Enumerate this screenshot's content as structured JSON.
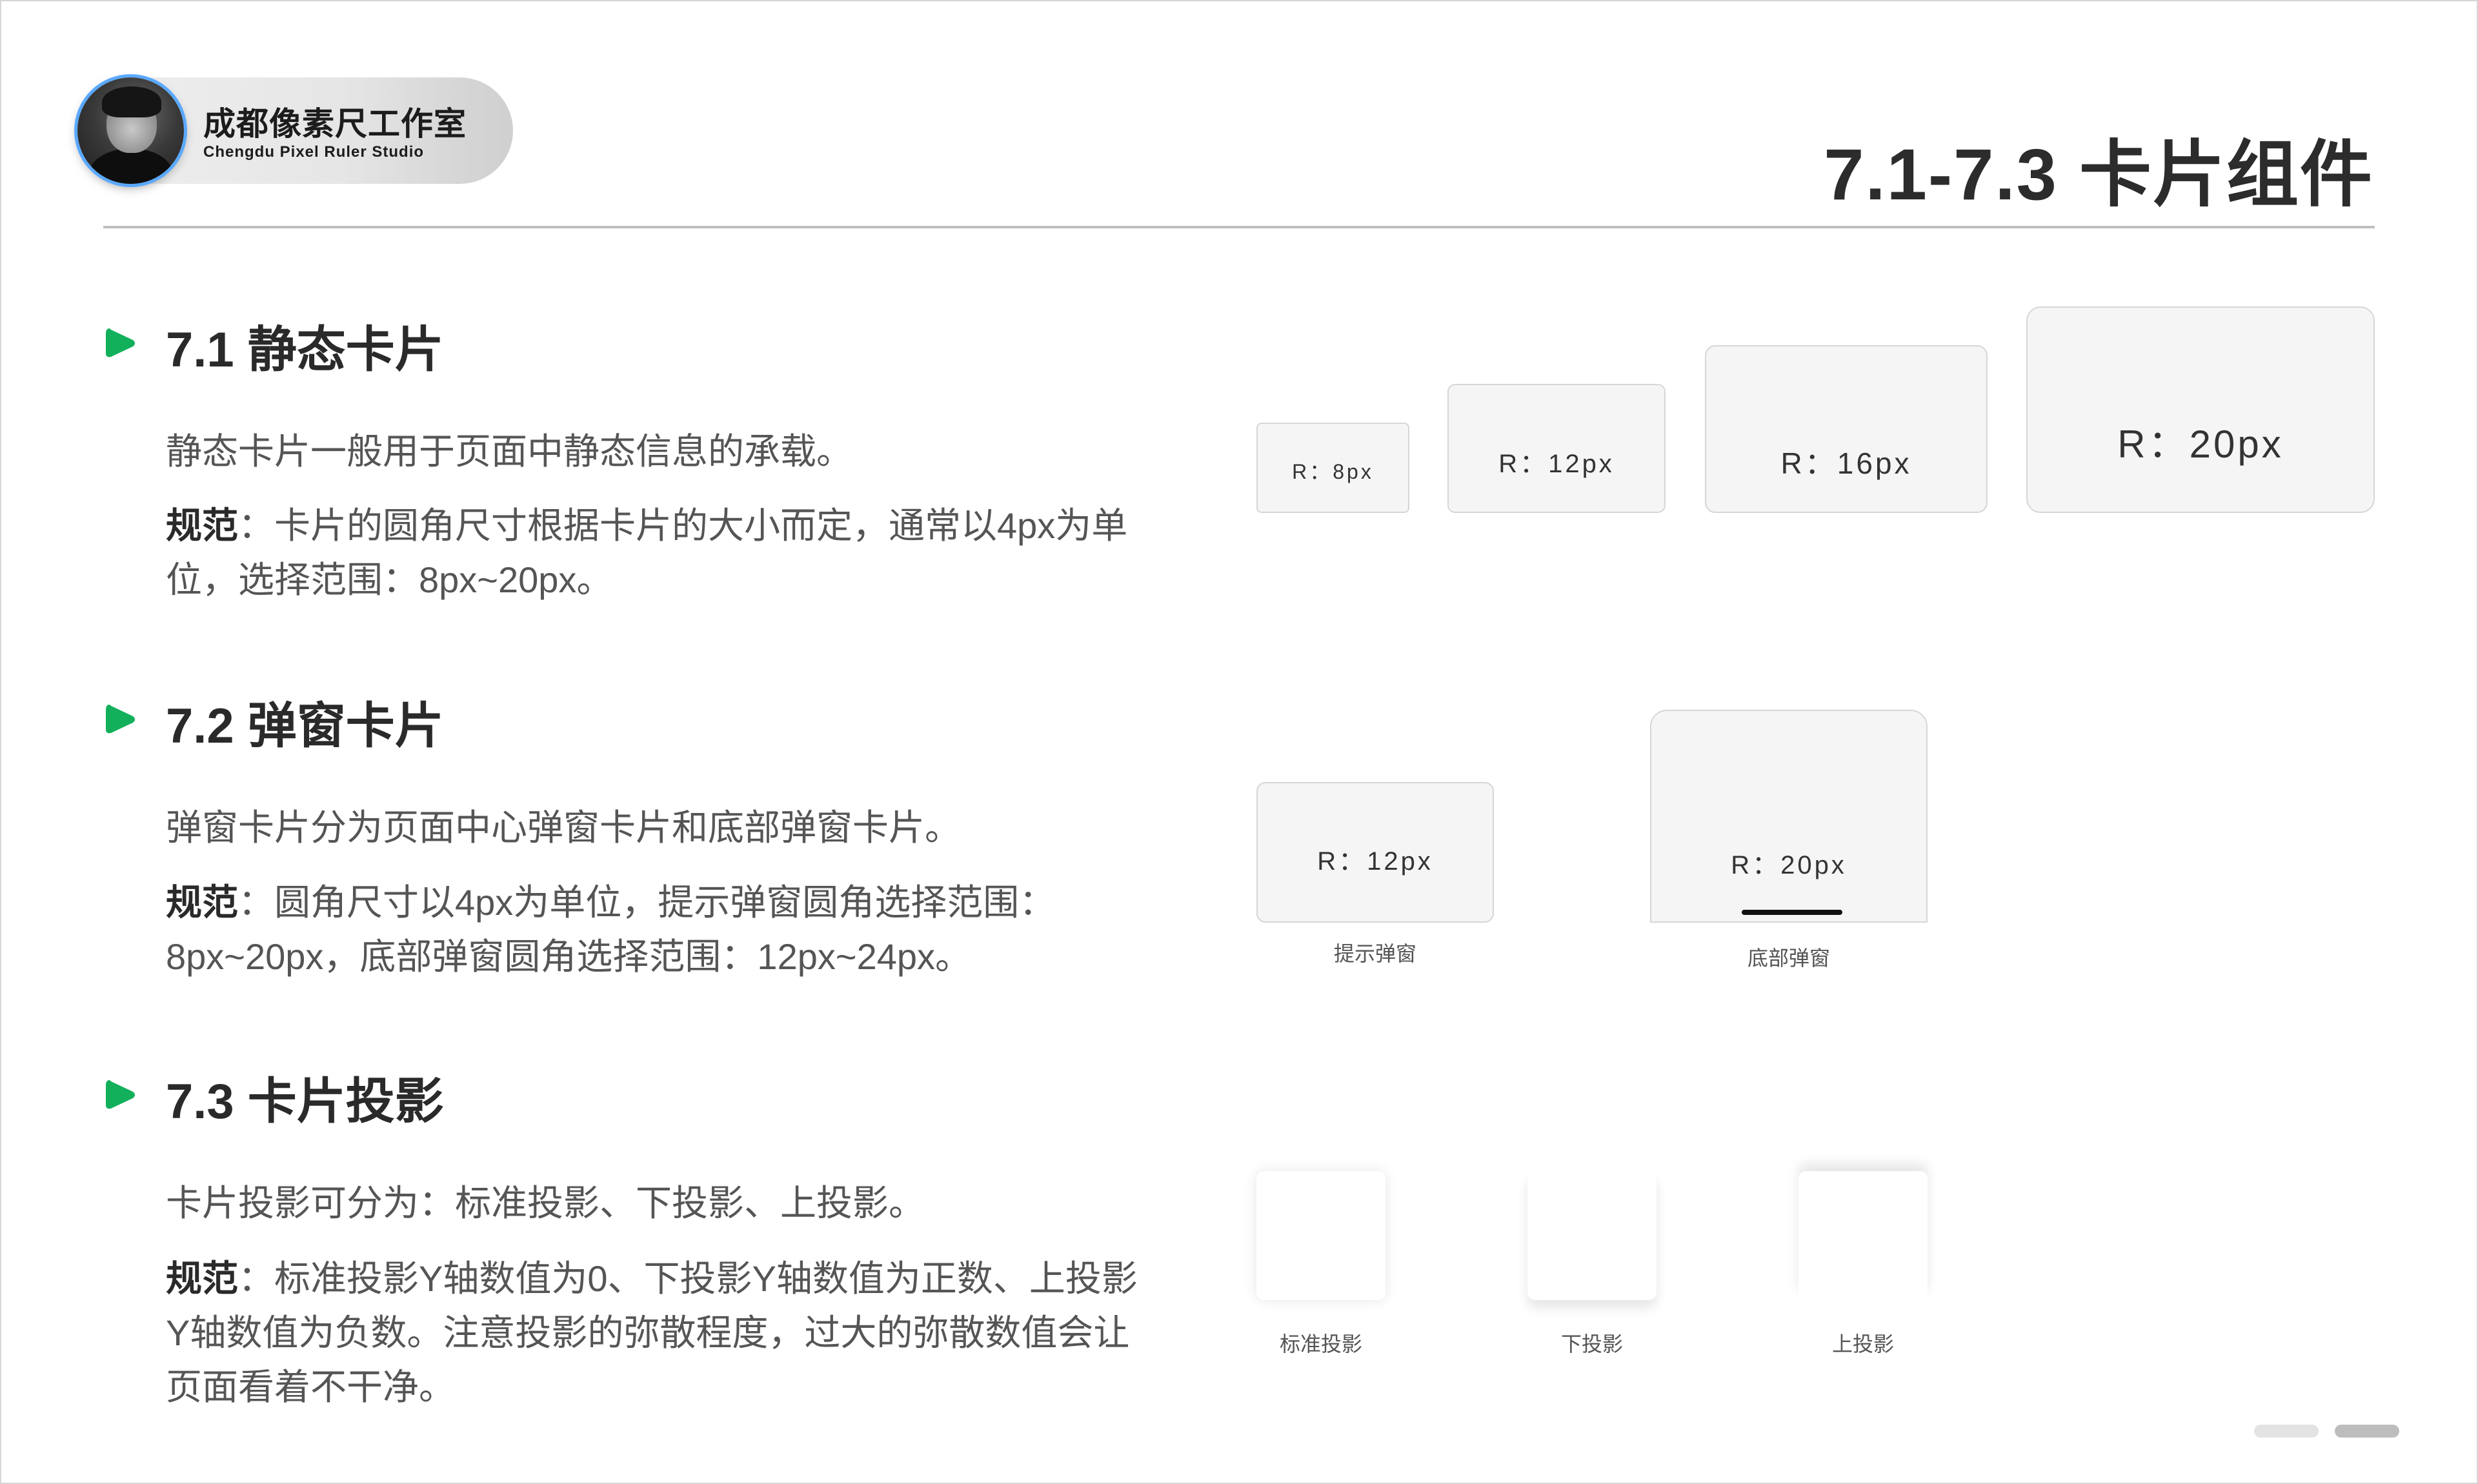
{
  "header": {
    "studio_name": "成都像素尺工作室",
    "studio_name_en": "Chengdu Pixel Ruler Studio",
    "page_title": "7.1-7.3 卡片组件"
  },
  "sections": [
    {
      "title": "7.1 静态卡片",
      "desc": "静态卡片一般用于页面中静态信息的承载。",
      "rule_label": "规范",
      "rule_text": "：卡片的圆角尺寸根据卡片的大小而定，通常以4px为单位，选择范围：8px~20px。"
    },
    {
      "title": "7.2 弹窗卡片",
      "desc": "弹窗卡片分为页面中心弹窗卡片和底部弹窗卡片。",
      "rule_label": "规范",
      "rule_text": "：圆角尺寸以4px为单位，提示弹窗圆角选择范围：8px~20px，底部弹窗圆角选择范围：12px~24px。"
    },
    {
      "title": "7.3 卡片投影",
      "desc": "卡片投影可分为：标准投影、下投影、上投影。",
      "rule_label": "规范",
      "rule_text": "：标准投影Y轴数值为0、下投影Y轴数值为正数、上投影Y轴数值为负数。注意投影的弥散程度，过大的弥散数值会让页面看着不干净。"
    }
  ],
  "static_cards": [
    {
      "label": "R：8px"
    },
    {
      "label": "R：12px"
    },
    {
      "label": "R：16px"
    },
    {
      "label": "R：20px"
    }
  ],
  "popup_cards": [
    {
      "label": "R：12px",
      "caption": "提示弹窗"
    },
    {
      "label": "R：20px",
      "caption": "底部弹窗"
    }
  ],
  "shadow_cards": [
    {
      "caption": "标准投影"
    },
    {
      "caption": "下投影"
    },
    {
      "caption": "上投影"
    }
  ],
  "colors": {
    "accent_green": "#12b05a",
    "pager_inactive": "#e3e3e3",
    "pager_active": "#bdbdbd"
  }
}
